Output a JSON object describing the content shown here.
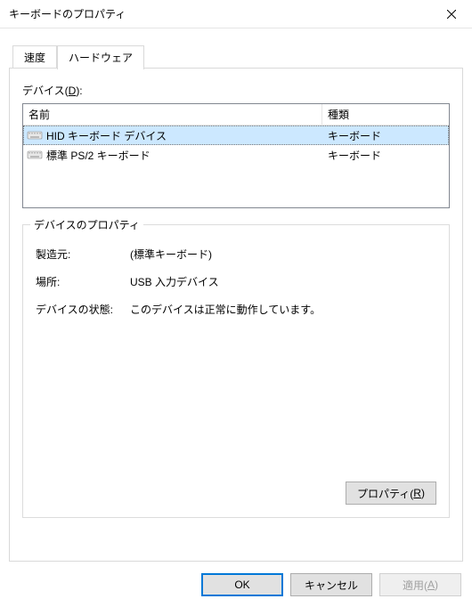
{
  "window": {
    "title": "キーボードのプロパティ"
  },
  "tabs": {
    "speed": "速度",
    "hardware": "ハードウェア"
  },
  "devices_label_pre": "デバイス(",
  "devices_label_key": "D",
  "devices_label_post": "):",
  "columns": {
    "name": "名前",
    "type": "種類"
  },
  "rows": [
    {
      "name": "HID キーボード デバイス",
      "type": "キーボード",
      "selected": true
    },
    {
      "name": "標準 PS/2 キーボード",
      "type": "キーボード",
      "selected": false
    }
  ],
  "group": {
    "title": "デバイスのプロパティ",
    "manufacturer_label": "製造元:",
    "manufacturer_value": "(標準キーボード)",
    "location_label": "場所:",
    "location_value": "USB 入力デバイス",
    "status_label": "デバイスの状態:",
    "status_value": "このデバイスは正常に動作しています。",
    "properties_btn_pre": "プロパティ(",
    "properties_btn_key": "R",
    "properties_btn_post": ")"
  },
  "footer": {
    "ok": "OK",
    "cancel": "キャンセル",
    "apply_pre": "適用(",
    "apply_key": "A",
    "apply_post": ")"
  }
}
